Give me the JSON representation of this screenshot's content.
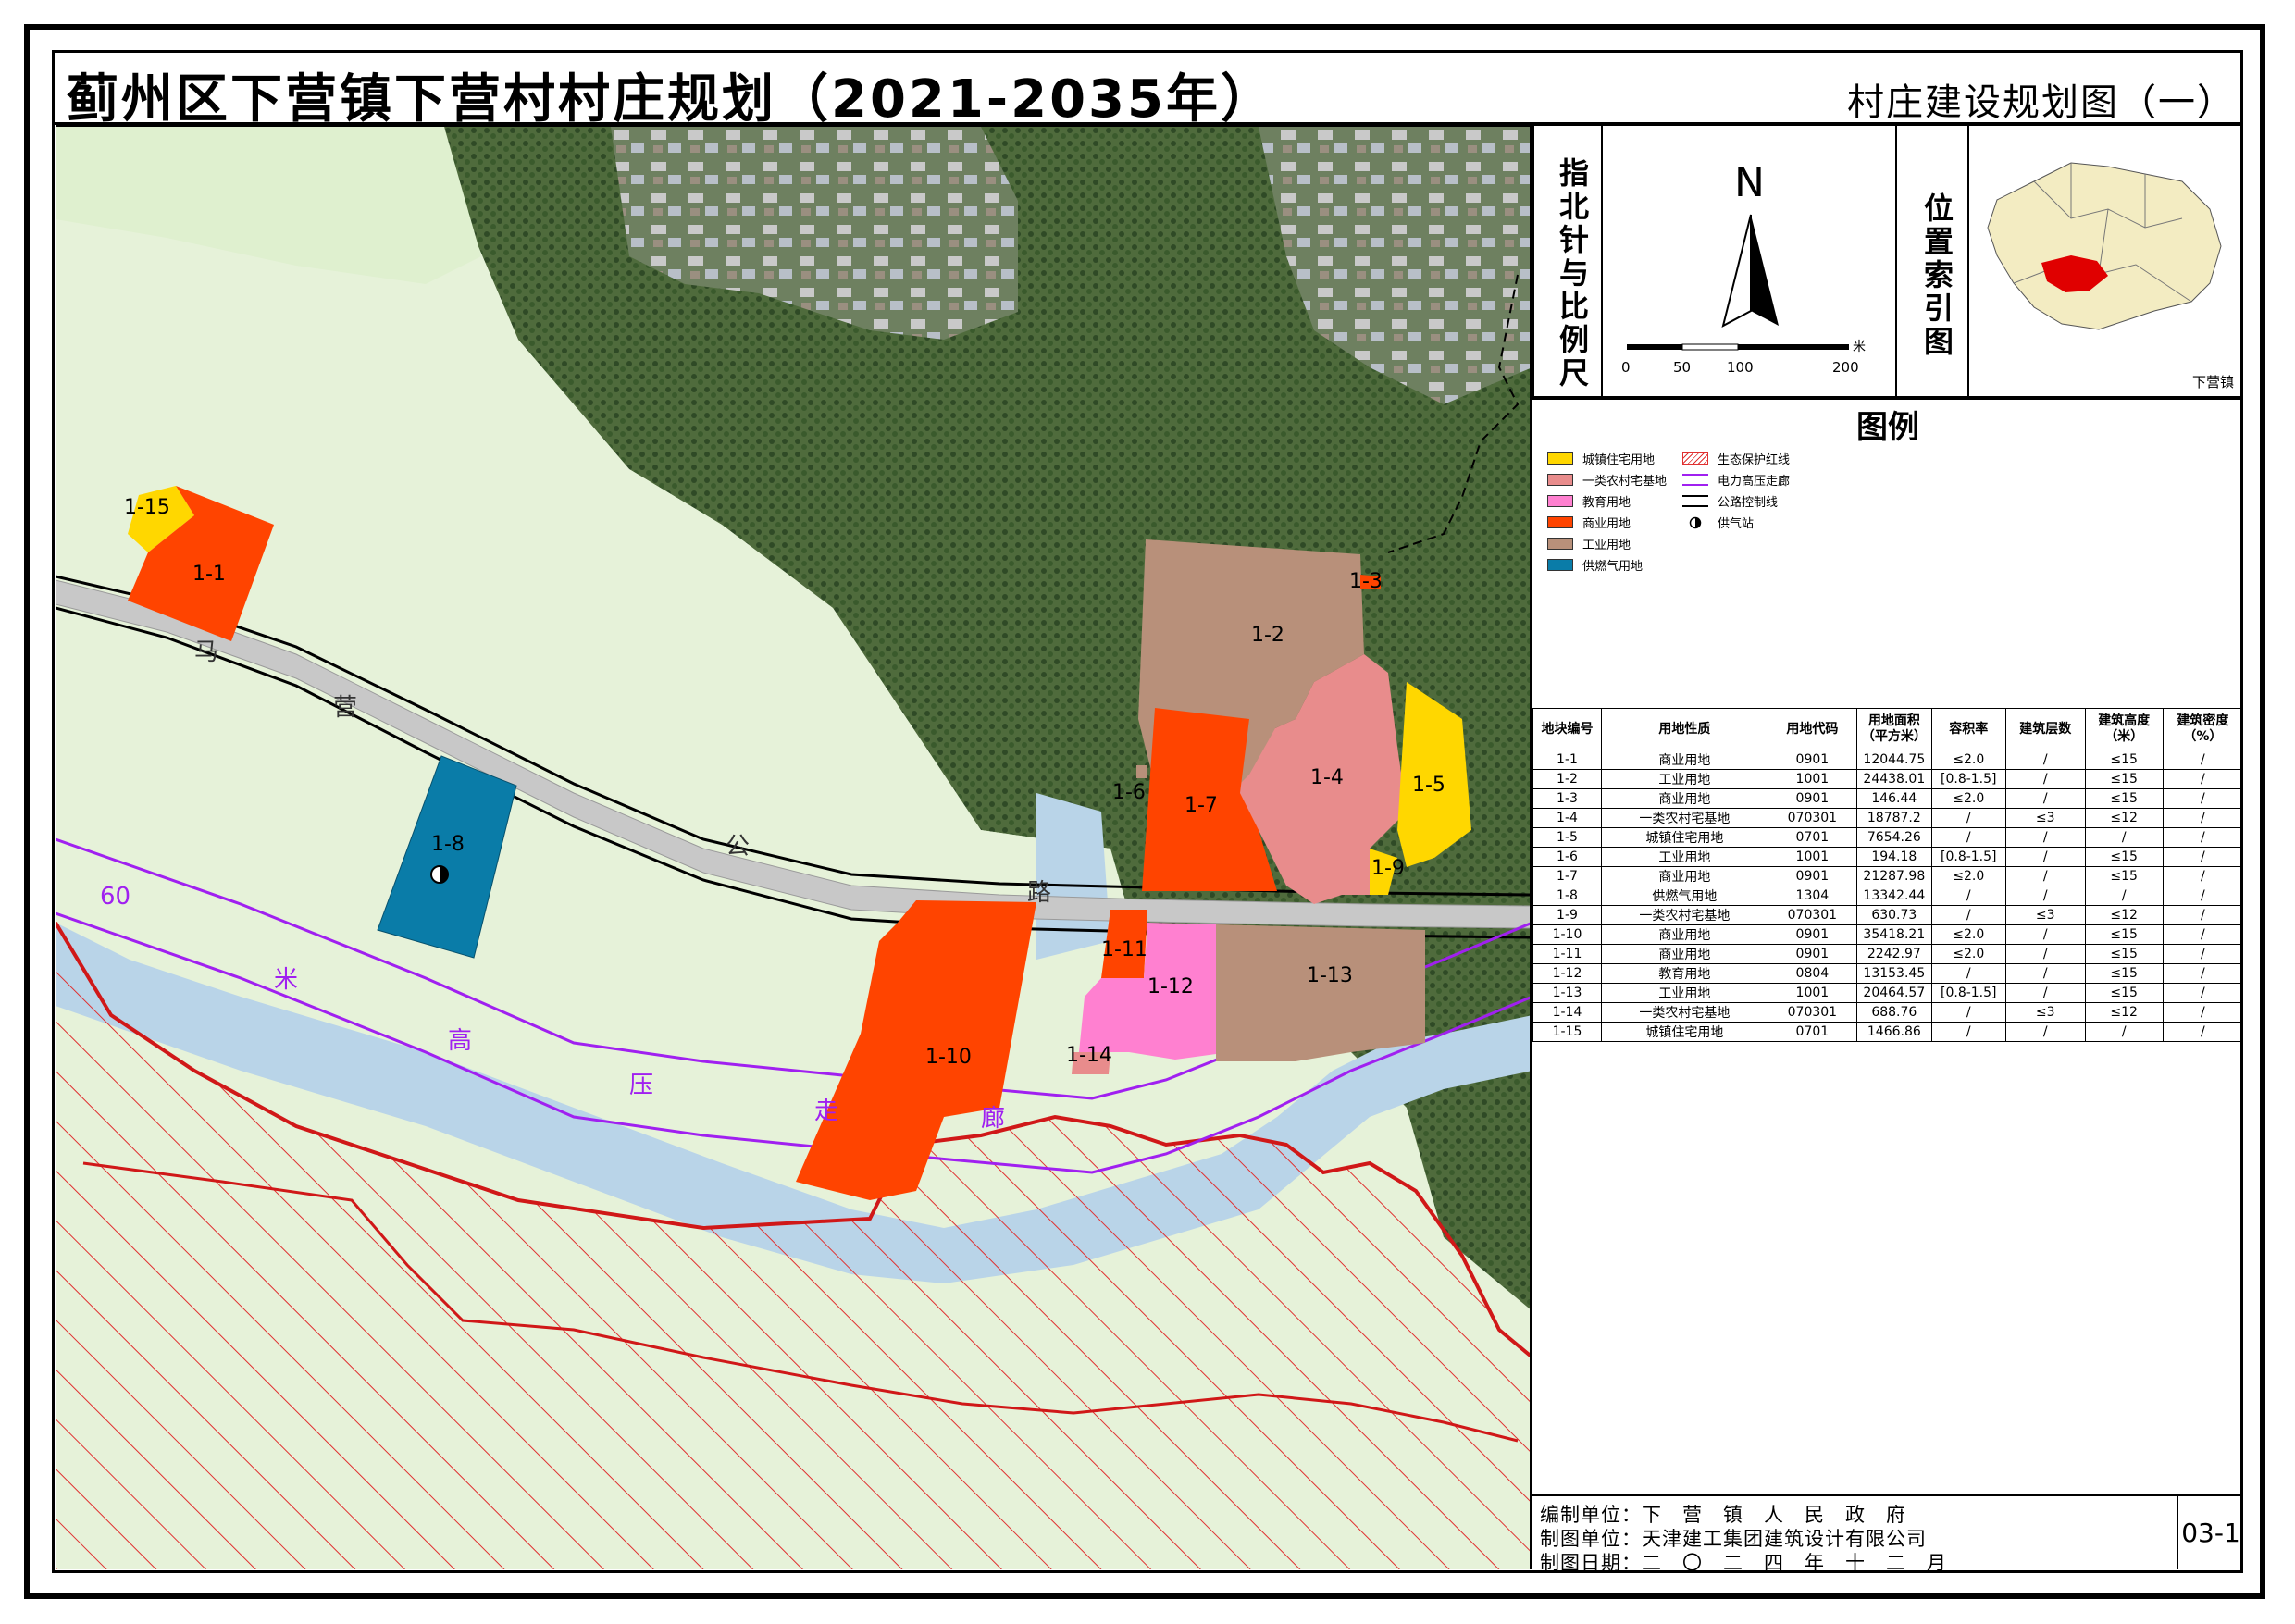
{
  "title": "蓟州区下营镇下营村村庄规划（2021-2035年）",
  "sheet_title": "村庄建设规划图（一）",
  "compass": {
    "section_label": "指北针与比例尺",
    "north": "N",
    "scale_ticks": [
      "0",
      "50",
      "100",
      "200"
    ],
    "scale_unit": "米"
  },
  "locator": {
    "section_label": "位置索引图",
    "town_label": "下营镇"
  },
  "legend": {
    "title": "图例",
    "items": [
      {
        "label": "城镇住宅用地",
        "color": "#FFD700",
        "kind": "fill"
      },
      {
        "label": "一类农村宅基地",
        "color": "#E88C8C",
        "kind": "fill"
      },
      {
        "label": "教育用地",
        "color": "#FF80D0",
        "kind": "fill"
      },
      {
        "label": "商业用地",
        "color": "#FF4400",
        "kind": "fill"
      },
      {
        "label": "工业用地",
        "color": "#B8907A",
        "kind": "fill"
      },
      {
        "label": "供燃气用地",
        "color": "#0A7CA8",
        "kind": "fill"
      },
      {
        "label": "生态保护红线",
        "color": "#E03030",
        "kind": "hatch"
      },
      {
        "label": "电力高压走廊",
        "color": "#A020F0",
        "kind": "double"
      },
      {
        "label": "公路控制线",
        "color": "#000000",
        "kind": "double-black"
      },
      {
        "label": "供气站",
        "color": "#000000",
        "kind": "symbol"
      }
    ]
  },
  "map_labels": {
    "parcels": [
      "1-1",
      "1-2",
      "1-3",
      "1-4",
      "1-5",
      "1-6",
      "1-7",
      "1-8",
      "1-9",
      "1-10",
      "1-11",
      "1-12",
      "1-13",
      "1-14",
      "1-15"
    ],
    "road": [
      "马",
      "营",
      "公",
      "路"
    ],
    "corridor": [
      "60",
      "米",
      "高",
      "压",
      "走",
      "廊"
    ]
  },
  "table": {
    "headers": [
      "地块编号",
      "用地性质",
      "用地代码",
      "用地面积（平方米）",
      "容积率",
      "建筑层数",
      "建筑高度（米）",
      "建筑密度（%）"
    ],
    "rows": [
      [
        "1-1",
        "商业用地",
        "0901",
        "12044.75",
        "≤2.0",
        "/",
        "≤15",
        "/"
      ],
      [
        "1-2",
        "工业用地",
        "1001",
        "24438.01",
        "[0.8-1.5]",
        "/",
        "≤15",
        "/"
      ],
      [
        "1-3",
        "商业用地",
        "0901",
        "146.44",
        "≤2.0",
        "/",
        "≤15",
        "/"
      ],
      [
        "1-4",
        "一类农村宅基地",
        "070301",
        "18787.2",
        "/",
        "≤3",
        "≤12",
        "/"
      ],
      [
        "1-5",
        "城镇住宅用地",
        "0701",
        "7654.26",
        "/",
        "/",
        "/",
        "/"
      ],
      [
        "1-6",
        "工业用地",
        "1001",
        "194.18",
        "[0.8-1.5]",
        "/",
        "≤15",
        "/"
      ],
      [
        "1-7",
        "商业用地",
        "0901",
        "21287.98",
        "≤2.0",
        "/",
        "≤15",
        "/"
      ],
      [
        "1-8",
        "供燃气用地",
        "1304",
        "13342.44",
        "/",
        "/",
        "/",
        "/"
      ],
      [
        "1-9",
        "一类农村宅基地",
        "070301",
        "630.73",
        "/",
        "≤3",
        "≤12",
        "/"
      ],
      [
        "1-10",
        "商业用地",
        "0901",
        "35418.21",
        "≤2.0",
        "/",
        "≤15",
        "/"
      ],
      [
        "1-11",
        "商业用地",
        "0901",
        "2242.97",
        "≤2.0",
        "/",
        "≤15",
        "/"
      ],
      [
        "1-12",
        "教育用地",
        "0804",
        "13153.45",
        "/",
        "/",
        "≤15",
        "/"
      ],
      [
        "1-13",
        "工业用地",
        "1001",
        "20464.57",
        "[0.8-1.5]",
        "/",
        "≤15",
        "/"
      ],
      [
        "1-14",
        "一类农村宅基地",
        "070301",
        "688.76",
        "/",
        "≤3",
        "≤12",
        "/"
      ],
      [
        "1-15",
        "城镇住宅用地",
        "0701",
        "1466.86",
        "/",
        "/",
        "/",
        "/"
      ]
    ]
  },
  "credits": {
    "compiler": "编制单位：下　营　镇　人　民　政　府",
    "designer": "制图单位：天津建工集团建筑设计有限公司",
    "date": "制图日期：二　〇　二　四　年　十　二　月",
    "sheet_no": "03-1"
  }
}
